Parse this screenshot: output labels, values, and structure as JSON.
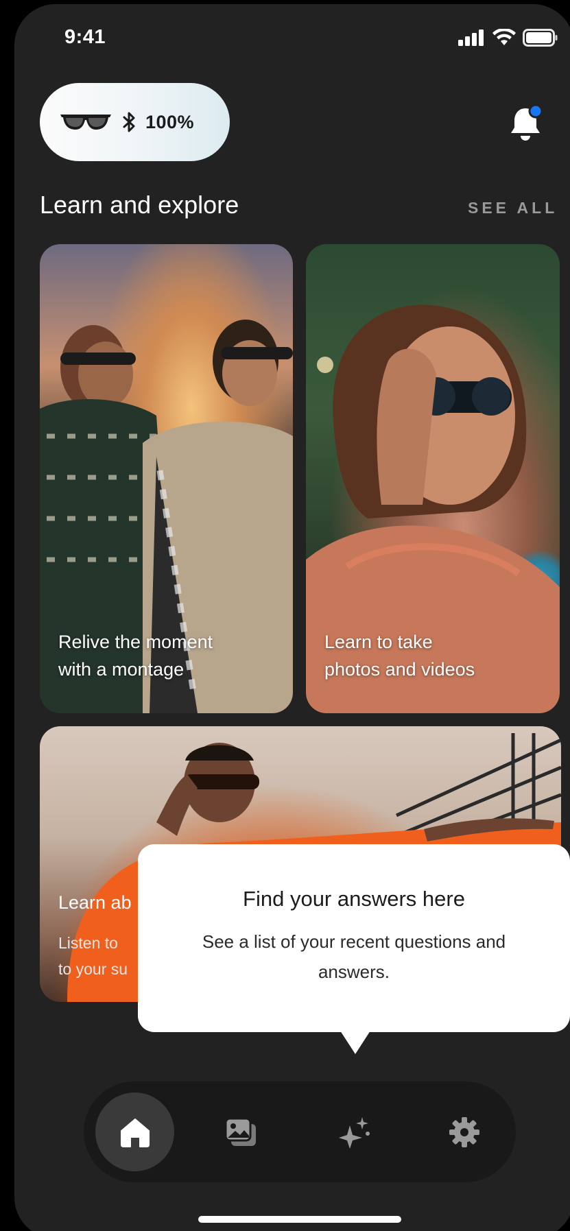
{
  "status_bar": {
    "time": "9:41",
    "icons": [
      "signal-icon",
      "wifi-icon",
      "battery-icon"
    ]
  },
  "device": {
    "icon": "glasses-icon",
    "connection_icon": "bluetooth-icon",
    "battery": "100%"
  },
  "notifications": {
    "icon": "bell-icon",
    "has_unread": true,
    "badge_color": "#1877f2"
  },
  "learn_section": {
    "title": "Learn and explore",
    "see_all": "SEE ALL",
    "cards": [
      {
        "title": "Relive the moment\nwith a montage"
      },
      {
        "title": "Learn to take\nphotos and videos"
      },
      {
        "title": "Learn ab",
        "subtitle": "Listen to\nto your su"
      }
    ]
  },
  "tooltip": {
    "title": "Find your answers here",
    "body": "See a list of your recent questions and answers."
  },
  "bottom_nav": {
    "items": [
      {
        "icon": "home-icon",
        "active": true
      },
      {
        "icon": "gallery-icon",
        "active": false
      },
      {
        "icon": "sparkle-ai-icon",
        "active": false
      },
      {
        "icon": "gear-icon",
        "active": false
      }
    ]
  },
  "colors": {
    "background": "#222222",
    "nav_background": "#191919",
    "active_nav": "#3a3a3a",
    "tooltip": "#ffffff"
  }
}
